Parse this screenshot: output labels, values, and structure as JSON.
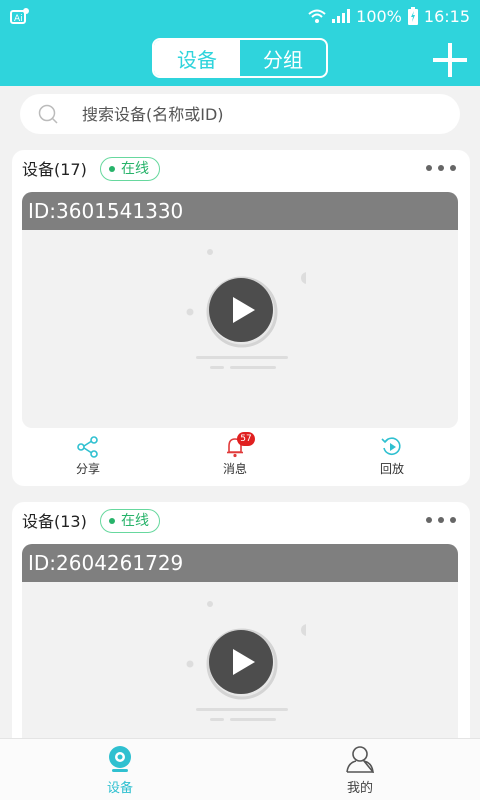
{
  "status_bar": {
    "battery": "100%",
    "time": "16:15"
  },
  "header": {
    "tabs": [
      {
        "label": "设备",
        "active": true
      },
      {
        "label": "分组",
        "active": false
      }
    ],
    "add_icon": "plus-icon"
  },
  "search": {
    "placeholder": "搜索设备(名称或ID)"
  },
  "devices": [
    {
      "title": "设备(17)",
      "status": "在线",
      "video_id": "ID:3601541330",
      "actions": [
        {
          "label": "分享",
          "icon": "share-icon"
        },
        {
          "label": "消息",
          "icon": "bell-icon",
          "badge": "57"
        },
        {
          "label": "回放",
          "icon": "playback-icon"
        }
      ]
    },
    {
      "title": "设备(13)",
      "status": "在线",
      "video_id": "ID:2604261729"
    }
  ],
  "bottom_nav": [
    {
      "label": "设备",
      "icon": "camera-icon",
      "active": true
    },
    {
      "label": "我的",
      "icon": "user-icon",
      "active": false
    }
  ],
  "colors": {
    "accent": "#2fd4dc",
    "online": "#27b36a",
    "badge": "#e02020"
  }
}
